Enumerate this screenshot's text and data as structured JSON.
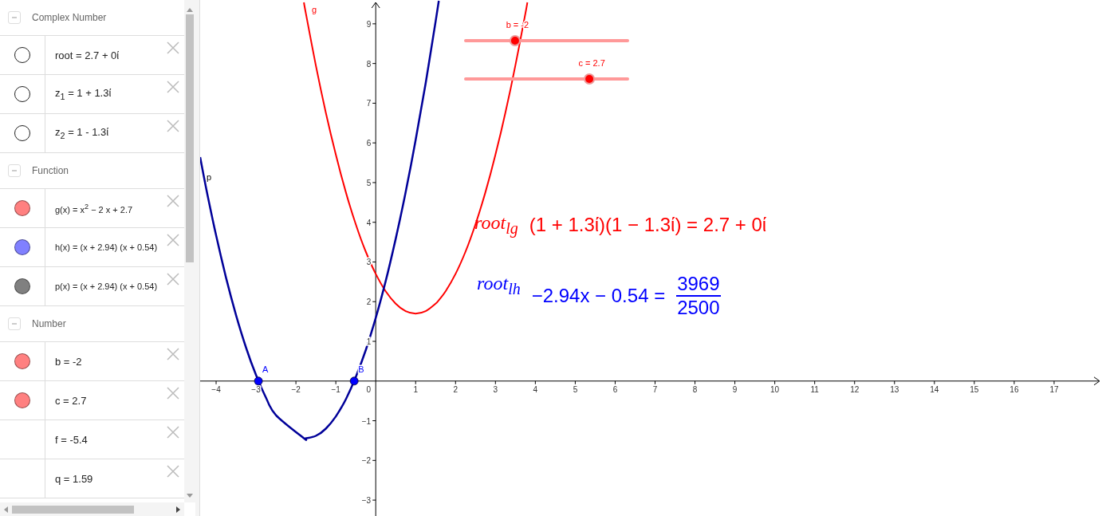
{
  "algebra": {
    "groups": [
      {
        "title": "Complex Number",
        "expanded": true,
        "items": [
          {
            "kind": "toggle",
            "visible": false,
            "text": "root = 2.7 + 0ί"
          },
          {
            "kind": "toggle",
            "visible": false,
            "text": "z$_{1}$ = 1 + 1.3ί"
          },
          {
            "kind": "toggle",
            "visible": false,
            "text": "z$_{2}$ = 1 - 1.3ί"
          }
        ]
      },
      {
        "title": "Function",
        "expanded": true,
        "items": [
          {
            "kind": "toggle",
            "visible": true,
            "color": "#ff8080",
            "text": "g(x) = x$^{2}$ − 2 x + 2.7"
          },
          {
            "kind": "toggle",
            "visible": true,
            "color": "#8080ff",
            "text": "h(x) = (x + 2.94) (x + 0.54)"
          },
          {
            "kind": "toggle",
            "visible": true,
            "color": "#808080",
            "text": "p(x) = (x + 2.94) (x + 0.54)"
          }
        ]
      },
      {
        "title": "Number",
        "expanded": true,
        "items": [
          {
            "kind": "toggle",
            "visible": true,
            "color": "#ff8080",
            "text": "b = -2"
          },
          {
            "kind": "toggle",
            "visible": true,
            "color": "#ff8080",
            "text": "c = 2.7"
          },
          {
            "kind": "plain",
            "text": "f = -5.4"
          },
          {
            "kind": "plain",
            "text": "q = 1.59"
          }
        ]
      }
    ]
  },
  "canvas": {
    "chart_data": {
      "type": "line",
      "xlim": [
        -4.4,
        18.2
      ],
      "ylim": [
        -3.4,
        9.6
      ],
      "x": [
        -4.4,
        -4.25,
        -4,
        -3.75,
        -3.5,
        -3.25,
        -3,
        -2.75,
        -2.5,
        -1.8,
        -1.75,
        -1.5,
        -1.25,
        -1,
        -0.75,
        -0.5,
        -0.25,
        0,
        0.25,
        0.5,
        0.75,
        1,
        1.25,
        1.5,
        1.58,
        1.75,
        2,
        2.25,
        2.5,
        2.75,
        3,
        3.25,
        3.5,
        3.75,
        3.8
      ],
      "series": [
        {
          "name": "g",
          "color": "#ff0000",
          "values": [
            null,
            null,
            null,
            null,
            null,
            null,
            null,
            null,
            null,
            9.54,
            9.26,
            7.95,
            6.76,
            5.7,
            4.76,
            3.95,
            3.26,
            2.7,
            2.26,
            1.95,
            1.76,
            1.7,
            1.76,
            1.95,
            2.04,
            2.26,
            2.7,
            3.26,
            3.95,
            4.76,
            5.7,
            6.76,
            7.95,
            9.26,
            9.54
          ]
        },
        {
          "name": "p",
          "color": "#000099",
          "values": [
            5.64,
            4.86,
            3.67,
            2.6,
            1.66,
            0.84,
            0.15,
            -0.42,
            -0.86,
            -1.44,
            -1.44,
            -1.38,
            -1.2,
            -0.89,
            -0.46,
            0.1,
            0.78,
            1.59,
            2.52,
            3.58,
            4.76,
            6.07,
            7.5,
            9.06,
            9.58,
            null,
            null,
            null,
            null,
            null,
            null,
            null,
            null,
            null,
            null
          ]
        }
      ],
      "xticks": [
        {
          "value": -4,
          "label": "−4"
        },
        {
          "value": -3,
          "label": "−3"
        },
        {
          "value": -2,
          "label": "−2"
        },
        {
          "value": -1,
          "label": "−1"
        },
        0,
        1,
        2,
        3,
        4,
        5,
        6,
        7,
        8,
        9,
        10,
        11,
        12,
        13,
        14,
        15,
        16,
        17
      ],
      "yticks": [
        9,
        8,
        7,
        6,
        5,
        4,
        3,
        2,
        1,
        {
          "value": -1,
          "label": "−1"
        },
        {
          "value": -2,
          "label": "−2"
        },
        {
          "value": -3,
          "label": "−3"
        }
      ]
    },
    "points": [
      {
        "label": "A"
      },
      {
        "label": "B"
      }
    ],
    "sliders": [
      {
        "label": "b = -2",
        "level": 0.305
      },
      {
        "label": "c = 2.7",
        "level": 0.764
      }
    ],
    "texts": [
      {
        "kind": "equation",
        "color": "#ff0000",
        "label": "root$_{lg}$",
        "body": "(1 + 1.3ί)(1 − 1.3ί) = 2.7 + 0ί"
      },
      {
        "kind": "fraction",
        "color": "#0000ff",
        "label": "root$_{lh}$",
        "body": "−2.94x − 0.54 =",
        "numerator": "3969",
        "denominator": "2500"
      }
    ]
  }
}
